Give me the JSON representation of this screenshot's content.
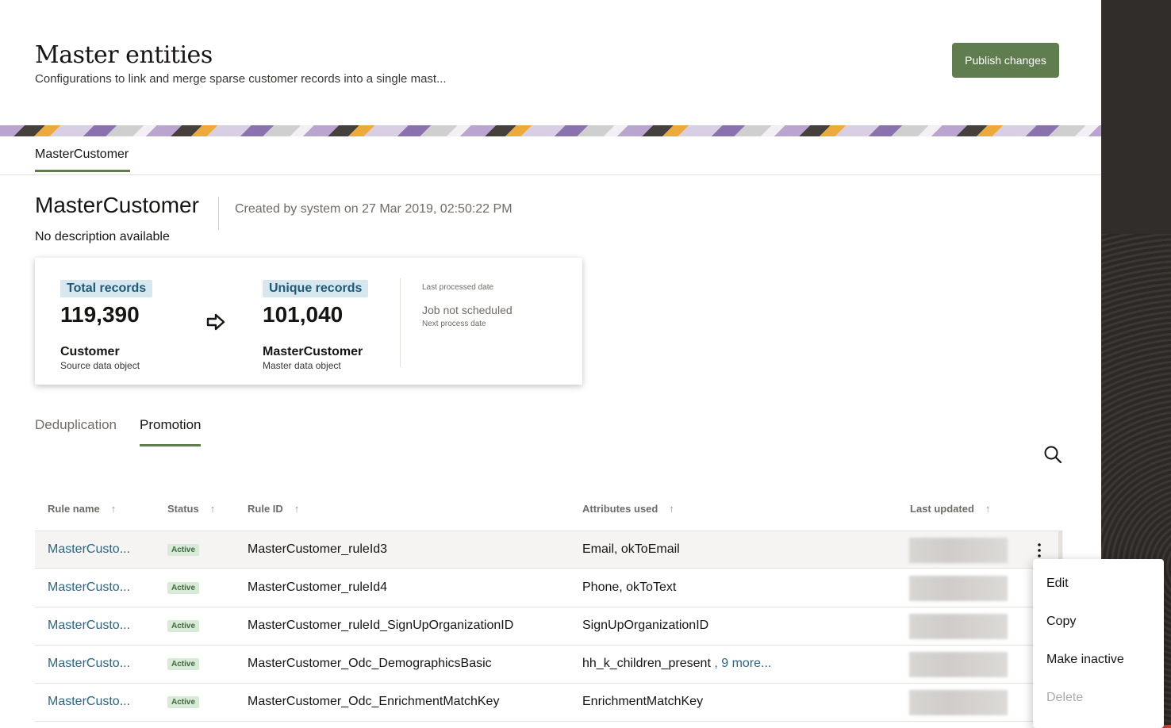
{
  "header": {
    "title": "Master entities",
    "subtitle": "Configurations to link and merge sparse customer records into a single mast...",
    "publish_label": "Publish changes"
  },
  "entity_tab": {
    "label": "MasterCustomer"
  },
  "entity": {
    "name": "MasterCustomer",
    "created": "Created by system on 27 Mar 2019, 02:50:22 PM",
    "description": "No description available"
  },
  "stats": {
    "total_label": "Total records",
    "total_value": "119,390",
    "total_name": "Customer",
    "total_sub": "Source data object",
    "unique_label": "Unique records",
    "unique_value": "101,040",
    "unique_name": "MasterCustomer",
    "unique_sub": "Master data object",
    "last_processed_label": "Last processed date",
    "job_status": "Job not scheduled",
    "next_process_label": "Next process date"
  },
  "sub_tabs": {
    "dedup": "Deduplication",
    "promotion": "Promotion"
  },
  "table": {
    "headers": {
      "rule_name": "Rule name",
      "status": "Status",
      "rule_id": "Rule ID",
      "attributes": "Attributes used",
      "last_updated": "Last updated"
    },
    "rows": [
      {
        "name": "MasterCusto...",
        "status": "Active",
        "rule_id": "MasterCustomer_ruleId3",
        "attributes": "Email, okToEmail",
        "more": ""
      },
      {
        "name": "MasterCusto...",
        "status": "Active",
        "rule_id": "MasterCustomer_ruleId4",
        "attributes": "Phone, okToText",
        "more": ""
      },
      {
        "name": "MasterCusto...",
        "status": "Active",
        "rule_id": "MasterCustomer_ruleId_SignUpOrganizationID",
        "attributes": "SignUpOrganizationID",
        "more": ""
      },
      {
        "name": "MasterCusto...",
        "status": "Active",
        "rule_id": "MasterCustomer_Odc_DemographicsBasic",
        "attributes": "hh_k_children_present",
        "more": " , 9 more..."
      },
      {
        "name": "MasterCusto...",
        "status": "Active",
        "rule_id": "MasterCustomer_Odc_EnrichmentMatchKey",
        "attributes": "EnrichmentMatchKey",
        "more": ""
      }
    ]
  },
  "menu": {
    "edit": "Edit",
    "copy": "Copy",
    "make_inactive": "Make inactive",
    "delete": "Delete"
  },
  "colors": {
    "primary_button": "#5f7d4f",
    "link": "#2a6684",
    "badge_bg": "#d9ead8",
    "badge_text": "#3d6b3c",
    "stat_label_bg": "#d7e7ef"
  }
}
